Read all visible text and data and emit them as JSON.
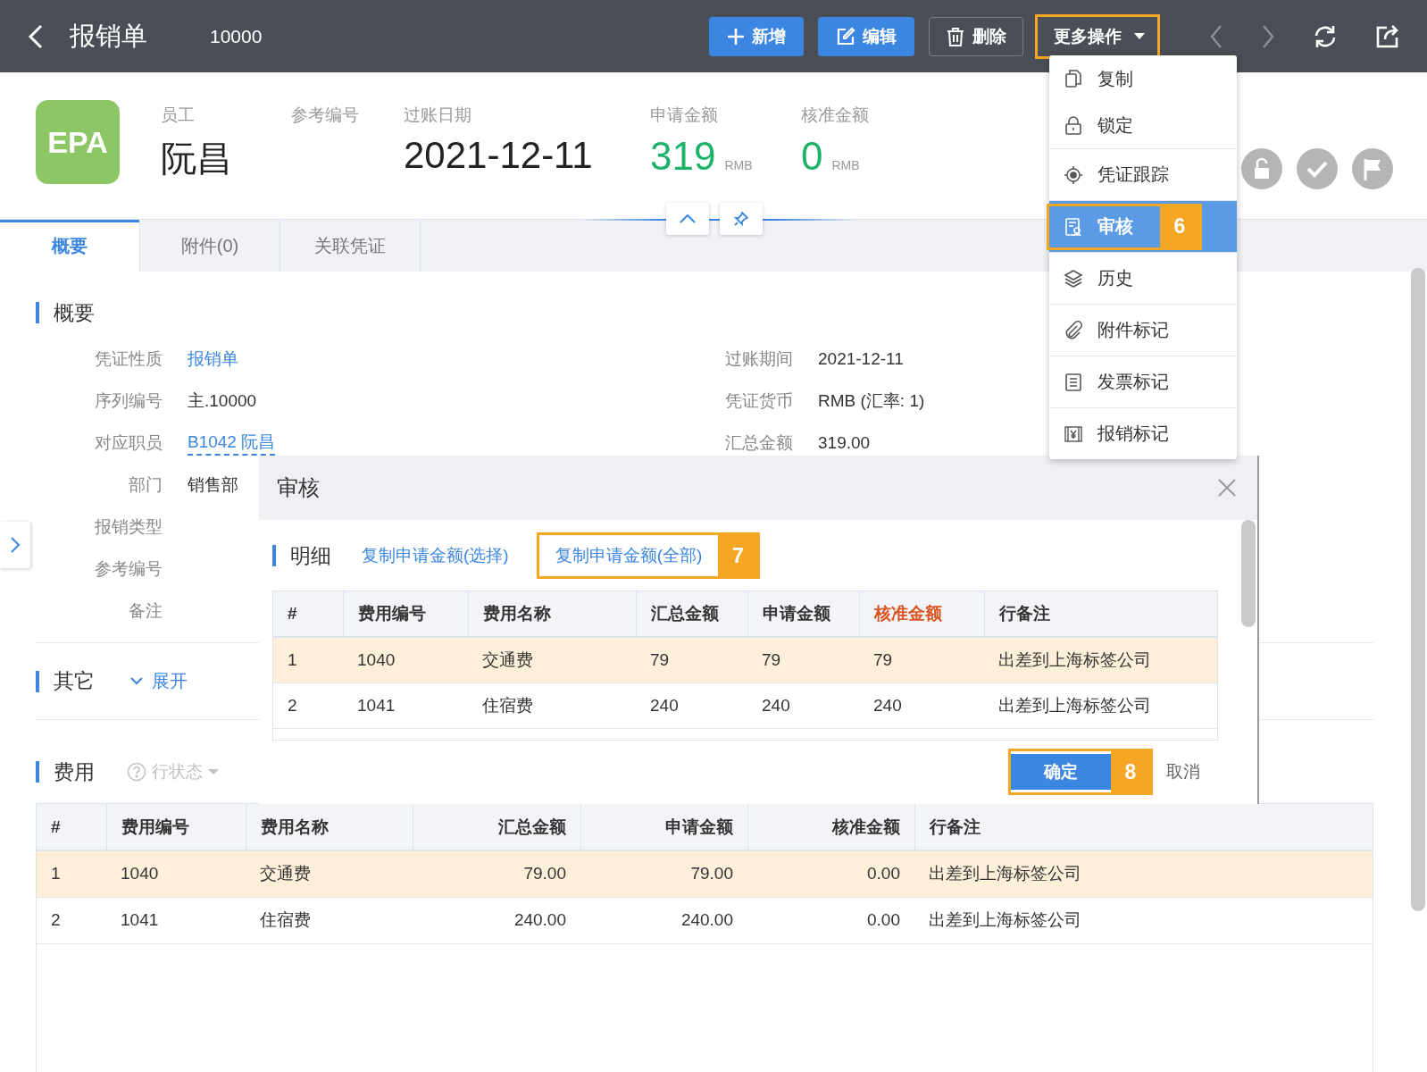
{
  "top_bar": {
    "title": "报销单",
    "doc_number": "10000",
    "buttons": [
      {
        "label": "新增",
        "kind": "add",
        "highlighted": false
      },
      {
        "label": "编辑",
        "kind": "edit",
        "highlighted": false
      },
      {
        "label": "删除",
        "kind": "delete",
        "highlighted": false
      },
      {
        "label": "更多操作",
        "kind": "more",
        "highlighted": true
      }
    ]
  },
  "more_menu": {
    "items": [
      {
        "label": "复制",
        "kind": "copy",
        "selected": false,
        "highlighted": false
      },
      {
        "label": "锁定",
        "kind": "lock",
        "selected": false,
        "highlighted": false
      },
      {
        "label": "凭证跟踪",
        "kind": "track",
        "selected": false,
        "highlighted": false
      },
      {
        "label": "审核",
        "kind": "audit",
        "selected": true,
        "highlighted": true,
        "callout": "6"
      },
      {
        "label": "历史",
        "kind": "history",
        "selected": false,
        "highlighted": false
      },
      {
        "label": "附件标记",
        "kind": "attachment",
        "selected": false,
        "highlighted": false
      },
      {
        "label": "发票标记",
        "kind": "invoice",
        "selected": false,
        "highlighted": false
      },
      {
        "label": "报销标记",
        "kind": "expense",
        "selected": false,
        "highlighted": false
      }
    ]
  },
  "header": {
    "logo": "EPA",
    "fields": [
      {
        "label": "员工",
        "value": "阮昌",
        "kind": "name"
      },
      {
        "label": "参考编号",
        "kind": "ref"
      },
      {
        "label": "过账日期",
        "value": "2021-12-11",
        "kind": "date"
      },
      {
        "label": "申请金额",
        "value": "319",
        "unit": "RMB",
        "kind": "amount"
      },
      {
        "label": "核准金额",
        "value": "0",
        "unit": "RMB",
        "kind": "amount"
      }
    ]
  },
  "tabs": [
    {
      "label": "概要",
      "selected": true
    },
    {
      "label": "附件(0)",
      "selected": false
    },
    {
      "label": "关联凭证",
      "selected": false
    }
  ],
  "summary": {
    "title": "概要",
    "left_fields": [
      {
        "label": "凭证性质",
        "value": "报销单",
        "kind": "link"
      },
      {
        "label": "序列编号",
        "value": "主.10000",
        "kind": "text"
      },
      {
        "label": "对应职员",
        "value": "B1042 阮昌",
        "kind": "dotted-link"
      },
      {
        "label": "部门",
        "value": "销售部",
        "kind": "text"
      },
      {
        "label": "报销类型"
      },
      {
        "label": "参考编号"
      },
      {
        "label": "备注"
      }
    ],
    "right_fields": [
      {
        "label": "过账期间",
        "value": "2021-12-11"
      },
      {
        "label": "凭证货币",
        "value": "RMB (汇率: 1)"
      },
      {
        "label": "汇总金额",
        "value": "319.00"
      }
    ]
  },
  "other_section": {
    "title": "其它",
    "toggle": "展开",
    "expanded": false
  },
  "expense_section": {
    "title": "费用",
    "row_status": {
      "label": "行状态",
      "disabled": true
    },
    "table": {
      "columns": [
        {
          "label": "#",
          "numeric": false
        },
        {
          "label": "费用编号",
          "numeric": false
        },
        {
          "label": "费用名称",
          "numeric": false
        },
        {
          "label": "汇总金额",
          "numeric": true
        },
        {
          "label": "申请金额",
          "numeric": true
        },
        {
          "label": "核准金额",
          "numeric": true
        },
        {
          "label": "行备注",
          "numeric": false
        }
      ],
      "rows": [
        {
          "selected": true,
          "cells": [
            "1",
            "1040",
            "交通费",
            "79.00",
            "79.00",
            "0.00",
            "出差到上海标签公司"
          ]
        },
        {
          "selected": false,
          "cells": [
            "2",
            "1041",
            "住宿费",
            "240.00",
            "240.00",
            "0.00",
            "出差到上海标签公司"
          ]
        }
      ]
    }
  },
  "audit_dialog": {
    "title": "审核",
    "section_title": "明细",
    "links": [
      {
        "label": "复制申请金额(选择)",
        "highlighted": false
      },
      {
        "label": "复制申请金额(全部)",
        "highlighted": true,
        "callout": "7"
      }
    ],
    "table": {
      "columns": [
        {
          "label": "#",
          "emphasized": false
        },
        {
          "label": "费用编号",
          "emphasized": false
        },
        {
          "label": "费用名称",
          "emphasized": false
        },
        {
          "label": "汇总金额",
          "emphasized": false
        },
        {
          "label": "申请金额",
          "emphasized": false
        },
        {
          "label": "核准金额",
          "emphasized": true
        },
        {
          "label": "行备注",
          "emphasized": false
        }
      ],
      "rows": [
        {
          "selected": true,
          "cells": [
            "1",
            "1040",
            "交通费",
            "79",
            "79",
            "79",
            "出差到上海标签公司"
          ]
        },
        {
          "selected": false,
          "cells": [
            "2",
            "1041",
            "住宿费",
            "240",
            "240",
            "240",
            "出差到上海标签公司"
          ]
        }
      ]
    },
    "confirm": {
      "label": "确定",
      "highlighted": true,
      "callout": "8"
    },
    "cancel": {
      "label": "取消"
    }
  }
}
